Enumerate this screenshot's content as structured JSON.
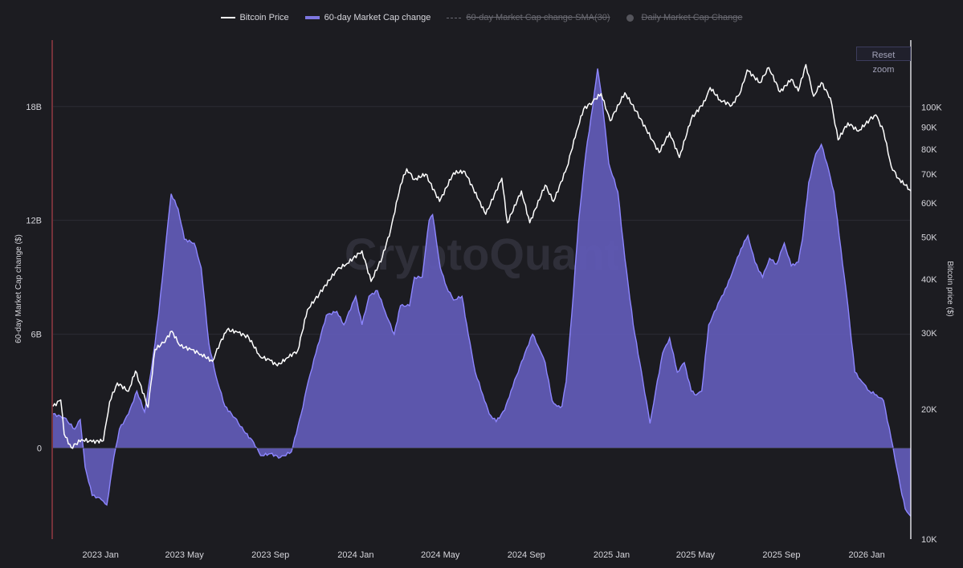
{
  "legend": {
    "items": [
      {
        "label": "Bitcoin Price",
        "enabled": true,
        "swatch": "line"
      },
      {
        "label": "60-day Market Cap change",
        "enabled": true,
        "swatch": "area"
      },
      {
        "label": "60-day Market Cap change SMA(30)",
        "enabled": false,
        "swatch": "dash"
      },
      {
        "label": "Daily Market Cap Change",
        "enabled": false,
        "swatch": "dot"
      }
    ]
  },
  "controls": {
    "reset_zoom_label": "Reset zoom"
  },
  "watermark": "CryptoQuant",
  "colors": {
    "background": "#1c1c21",
    "area_fill": "#625bb8",
    "area_stroke": "#8d86ff",
    "price_line": "#ffffff",
    "grid": "#2c2c34",
    "left_edge": "#b0404a"
  },
  "chart_data": {
    "type": "area",
    "x_tick_labels": [
      "2023 Jan",
      "2023 May",
      "2023 Sep",
      "2024 Jan",
      "2024 May",
      "2024 Sep",
      "2025 Jan",
      "2025 May",
      "2025 Sep",
      "2026 Jan"
    ],
    "x_range": [
      "2022-10-25",
      "2026-03-05"
    ],
    "y_left": {
      "label": "60-day Market Cap change ($)",
      "tick_labels": [
        "0",
        "6B",
        "12B",
        "18B"
      ],
      "ticks": [
        0,
        6,
        12,
        18
      ],
      "units": "B",
      "range": [
        -4.8,
        21.5
      ]
    },
    "y_right": {
      "label": "Bitcoin price ($)",
      "scale": "log",
      "tick_labels": [
        "10K",
        "20K",
        "30K",
        "40K",
        "50K",
        "60K",
        "70K",
        "80K",
        "90K",
        "100K"
      ],
      "ticks": [
        10000,
        20000,
        30000,
        40000,
        50000,
        60000,
        70000,
        80000,
        90000,
        100000
      ],
      "range": [
        10000,
        143000
      ]
    },
    "series": [
      {
        "name": "60-day Market Cap change",
        "axis": "left",
        "points": [
          [
            "2022-10-25",
            1.8
          ],
          [
            "2022-11-10",
            1.6
          ],
          [
            "2022-11-25",
            1.0
          ],
          [
            "2022-12-03",
            1.5
          ],
          [
            "2022-12-10",
            -1.0
          ],
          [
            "2022-12-20",
            -2.5
          ],
          [
            "2022-12-28",
            -2.6
          ],
          [
            "2023-01-05",
            -2.8
          ],
          [
            "2023-01-10",
            -3.0
          ],
          [
            "2023-01-20",
            -0.5
          ],
          [
            "2023-01-28",
            1.0
          ],
          [
            "2023-02-10",
            1.8
          ],
          [
            "2023-02-22",
            3.0
          ],
          [
            "2023-03-05",
            1.9
          ],
          [
            "2023-03-15",
            4.2
          ],
          [
            "2023-03-25",
            7.0
          ],
          [
            "2023-04-05",
            11.0
          ],
          [
            "2023-04-12",
            13.4
          ],
          [
            "2023-04-22",
            12.6
          ],
          [
            "2023-05-01",
            11.0
          ],
          [
            "2023-05-15",
            10.8
          ],
          [
            "2023-05-25",
            9.5
          ],
          [
            "2023-06-05",
            5.5
          ],
          [
            "2023-06-15",
            3.8
          ],
          [
            "2023-06-28",
            2.2
          ],
          [
            "2023-07-12",
            1.6
          ],
          [
            "2023-07-25",
            0.9
          ],
          [
            "2023-08-08",
            0.3
          ],
          [
            "2023-08-18",
            -0.4
          ],
          [
            "2023-09-01",
            -0.3
          ],
          [
            "2023-09-15",
            -0.5
          ],
          [
            "2023-10-01",
            -0.2
          ],
          [
            "2023-10-15",
            1.8
          ],
          [
            "2023-10-25",
            3.5
          ],
          [
            "2023-11-05",
            5.0
          ],
          [
            "2023-11-20",
            7.0
          ],
          [
            "2023-12-05",
            7.2
          ],
          [
            "2023-12-15",
            6.5
          ],
          [
            "2024-01-01",
            8.0
          ],
          [
            "2024-01-10",
            6.5
          ],
          [
            "2024-01-20",
            8.0
          ],
          [
            "2024-02-01",
            8.3
          ],
          [
            "2024-02-12",
            7.2
          ],
          [
            "2024-02-25",
            6.0
          ],
          [
            "2024-03-05",
            7.5
          ],
          [
            "2024-03-18",
            7.5
          ],
          [
            "2024-03-25",
            9.0
          ],
          [
            "2024-04-05",
            9.0
          ],
          [
            "2024-04-15",
            12.0
          ],
          [
            "2024-04-20",
            12.3
          ],
          [
            "2024-05-01",
            9.5
          ],
          [
            "2024-05-10",
            8.5
          ],
          [
            "2024-05-20",
            7.8
          ],
          [
            "2024-06-01",
            8.0
          ],
          [
            "2024-06-10",
            6.0
          ],
          [
            "2024-06-20",
            4.0
          ],
          [
            "2024-07-01",
            2.8
          ],
          [
            "2024-07-10",
            1.8
          ],
          [
            "2024-07-20",
            1.4
          ],
          [
            "2024-08-01",
            2.0
          ],
          [
            "2024-08-10",
            3.0
          ],
          [
            "2024-08-18",
            3.8
          ],
          [
            "2024-08-30",
            5.0
          ],
          [
            "2024-09-10",
            6.0
          ],
          [
            "2024-09-20",
            5.2
          ],
          [
            "2024-09-28",
            4.5
          ],
          [
            "2024-10-08",
            2.5
          ],
          [
            "2024-10-15",
            2.2
          ],
          [
            "2024-10-22",
            2.2
          ],
          [
            "2024-10-28",
            3.5
          ],
          [
            "2024-11-05",
            7.0
          ],
          [
            "2024-11-15",
            12.0
          ],
          [
            "2024-11-25",
            15.5
          ],
          [
            "2024-12-05",
            18.0
          ],
          [
            "2024-12-12",
            20.0
          ],
          [
            "2024-12-18",
            18.5
          ],
          [
            "2024-12-28",
            15.0
          ],
          [
            "2025-01-10",
            13.5
          ],
          [
            "2025-01-20",
            10.0
          ],
          [
            "2025-02-01",
            6.5
          ],
          [
            "2025-02-15",
            3.5
          ],
          [
            "2025-02-25",
            1.3
          ],
          [
            "2025-03-05",
            3.0
          ],
          [
            "2025-03-15",
            5.0
          ],
          [
            "2025-03-25",
            5.8
          ],
          [
            "2025-04-05",
            4.0
          ],
          [
            "2025-04-15",
            4.5
          ],
          [
            "2025-04-25",
            3.0
          ],
          [
            "2025-05-02",
            2.8
          ],
          [
            "2025-05-10",
            3.0
          ],
          [
            "2025-05-20",
            6.5
          ],
          [
            "2025-06-05",
            7.8
          ],
          [
            "2025-06-15",
            8.5
          ],
          [
            "2025-06-25",
            9.5
          ],
          [
            "2025-07-05",
            10.5
          ],
          [
            "2025-07-15",
            11.2
          ],
          [
            "2025-07-25",
            9.8
          ],
          [
            "2025-08-05",
            9.0
          ],
          [
            "2025-08-15",
            10.0
          ],
          [
            "2025-08-25",
            9.7
          ],
          [
            "2025-09-05",
            10.8
          ],
          [
            "2025-09-15",
            9.6
          ],
          [
            "2025-09-25",
            9.8
          ],
          [
            "2025-10-01",
            11.0
          ],
          [
            "2025-10-10",
            14.0
          ],
          [
            "2025-10-20",
            15.5
          ],
          [
            "2025-10-28",
            16.0
          ],
          [
            "2025-11-05",
            15.0
          ],
          [
            "2025-11-15",
            13.5
          ],
          [
            "2025-11-25",
            10.5
          ],
          [
            "2025-12-05",
            7.5
          ],
          [
            "2025-12-15",
            4.0
          ],
          [
            "2025-12-25",
            3.5
          ],
          [
            "2026-01-05",
            3.0
          ],
          [
            "2026-01-15",
            2.8
          ],
          [
            "2026-01-25",
            2.5
          ],
          [
            "2026-02-05",
            0.5
          ],
          [
            "2026-02-10",
            -0.5
          ],
          [
            "2026-02-18",
            -2.0
          ],
          [
            "2026-02-25",
            -3.2
          ],
          [
            "2026-03-05",
            -3.6
          ]
        ]
      },
      {
        "name": "Bitcoin Price",
        "axis": "right",
        "points": [
          [
            "2022-10-25",
            20300
          ],
          [
            "2022-11-05",
            21000
          ],
          [
            "2022-11-10",
            17500
          ],
          [
            "2022-11-20",
            16300
          ],
          [
            "2022-12-05",
            17000
          ],
          [
            "2022-12-20",
            16800
          ],
          [
            "2023-01-05",
            16900
          ],
          [
            "2023-01-14",
            20800
          ],
          [
            "2023-01-25",
            23000
          ],
          [
            "2023-02-10",
            22000
          ],
          [
            "2023-02-20",
            24500
          ],
          [
            "2023-03-10",
            20200
          ],
          [
            "2023-03-20",
            27500
          ],
          [
            "2023-04-01",
            28500
          ],
          [
            "2023-04-13",
            30300
          ],
          [
            "2023-04-25",
            28000
          ],
          [
            "2023-05-10",
            27500
          ],
          [
            "2023-05-25",
            26800
          ],
          [
            "2023-06-10",
            25800
          ],
          [
            "2023-06-21",
            28500
          ],
          [
            "2023-07-01",
            30500
          ],
          [
            "2023-07-15",
            30200
          ],
          [
            "2023-08-01",
            29300
          ],
          [
            "2023-08-17",
            26500
          ],
          [
            "2023-09-01",
            25900
          ],
          [
            "2023-09-11",
            25200
          ],
          [
            "2023-09-25",
            26300
          ],
          [
            "2023-10-10",
            27300
          ],
          [
            "2023-10-24",
            34000
          ],
          [
            "2023-11-10",
            37000
          ],
          [
            "2023-12-05",
            42000
          ],
          [
            "2023-12-20",
            43500
          ],
          [
            "2024-01-10",
            46500
          ],
          [
            "2024-01-23",
            39500
          ],
          [
            "2024-02-08",
            45000
          ],
          [
            "2024-02-20",
            52000
          ],
          [
            "2024-03-05",
            66000
          ],
          [
            "2024-03-14",
            72000
          ],
          [
            "2024-03-25",
            68000
          ],
          [
            "2024-04-10",
            70000
          ],
          [
            "2024-04-30",
            60500
          ],
          [
            "2024-05-20",
            70500
          ],
          [
            "2024-06-05",
            71000
          ],
          [
            "2024-06-25",
            61000
          ],
          [
            "2024-07-05",
            56500
          ],
          [
            "2024-07-28",
            68500
          ],
          [
            "2024-08-05",
            54000
          ],
          [
            "2024-08-25",
            64000
          ],
          [
            "2024-09-06",
            54000
          ],
          [
            "2024-09-28",
            66000
          ],
          [
            "2024-10-10",
            60500
          ],
          [
            "2024-10-29",
            72500
          ],
          [
            "2024-11-12",
            88000
          ],
          [
            "2024-11-22",
            99000
          ],
          [
            "2024-12-05",
            103000
          ],
          [
            "2024-12-17",
            107500
          ],
          [
            "2024-12-30",
            93000
          ],
          [
            "2025-01-20",
            108000
          ],
          [
            "2025-02-05",
            98000
          ],
          [
            "2025-02-28",
            84000
          ],
          [
            "2025-03-10",
            78500
          ],
          [
            "2025-03-25",
            87500
          ],
          [
            "2025-04-08",
            76500
          ],
          [
            "2025-04-25",
            94000
          ],
          [
            "2025-05-15",
            103500
          ],
          [
            "2025-05-22",
            111000
          ],
          [
            "2025-06-05",
            104000
          ],
          [
            "2025-06-22",
            101000
          ],
          [
            "2025-07-05",
            109000
          ],
          [
            "2025-07-14",
            122000
          ],
          [
            "2025-08-01",
            114000
          ],
          [
            "2025-08-14",
            123500
          ],
          [
            "2025-08-30",
            108500
          ],
          [
            "2025-09-15",
            116000
          ],
          [
            "2025-09-25",
            109000
          ],
          [
            "2025-10-06",
            125500
          ],
          [
            "2025-10-17",
            106000
          ],
          [
            "2025-10-28",
            114000
          ],
          [
            "2025-11-10",
            105000
          ],
          [
            "2025-11-21",
            84000
          ],
          [
            "2025-12-05",
            92000
          ],
          [
            "2025-12-20",
            88000
          ],
          [
            "2026-01-05",
            93500
          ],
          [
            "2026-01-14",
            96000
          ],
          [
            "2026-01-25",
            88000
          ],
          [
            "2026-02-05",
            73000
          ],
          [
            "2026-02-15",
            68500
          ],
          [
            "2026-02-25",
            66000
          ],
          [
            "2026-03-05",
            64000
          ]
        ]
      }
    ]
  }
}
